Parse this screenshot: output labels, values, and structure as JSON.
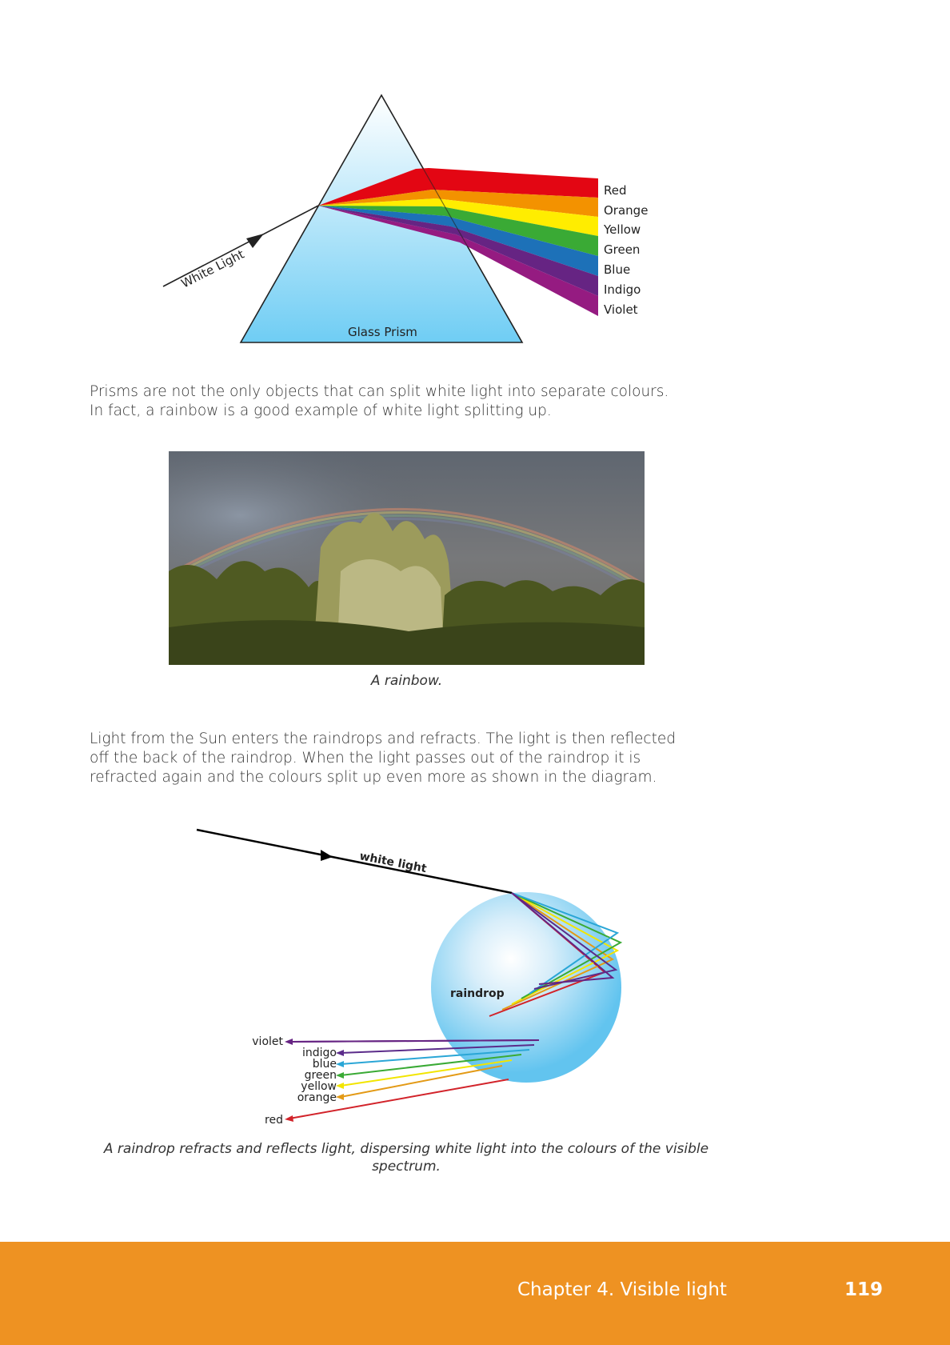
{
  "prism_diagram": {
    "white_light_label": "White Light",
    "prism_label": "Glass Prism",
    "spectrum": [
      {
        "name": "Red",
        "color": "#e30613"
      },
      {
        "name": "Orange",
        "color": "#f39200"
      },
      {
        "name": "Yellow",
        "color": "#ffed00"
      },
      {
        "name": "Green",
        "color": "#3aaa35"
      },
      {
        "name": "Blue",
        "color": "#1d71b8"
      },
      {
        "name": "Indigo",
        "color": "#662483"
      },
      {
        "name": "Violet",
        "color": "#951b81"
      }
    ]
  },
  "paragraph_1": {
    "line_1": "Prisms are not the only objects that can split white light into separate colours.",
    "line_2": "In fact, a rainbow is a good example of white light splitting up."
  },
  "photo_caption": "A rainbow.",
  "paragraph_2": {
    "line_1": "Light from the Sun enters the raindrops and refracts.  The light is then reflected",
    "line_2": "off the back of the raindrop. When the light passes out of the raindrop it is",
    "line_3": "refracted again and the colours split up even more as shown in the diagram."
  },
  "raindrop_diagram": {
    "white_light_label": "white light",
    "drop_label": "raindrop",
    "rays": [
      {
        "name": "violet",
        "color": "#662483"
      },
      {
        "name": "indigo",
        "color": "#5b2c8a"
      },
      {
        "name": "blue",
        "color": "#2aa6d6"
      },
      {
        "name": "green",
        "color": "#3aaa35"
      },
      {
        "name": "yellow",
        "color": "#f2e500"
      },
      {
        "name": "orange",
        "color": "#e39a16"
      },
      {
        "name": "red",
        "color": "#d2232a"
      }
    ]
  },
  "raindrop_caption": {
    "line_1": "A raindrop refracts and reflects light, dispersing white light into the colours of the visible",
    "line_2": "spectrum."
  },
  "footer": {
    "chapter": "Chapter 4.   Visible light",
    "page_number": "119",
    "color": "#ee9222"
  }
}
